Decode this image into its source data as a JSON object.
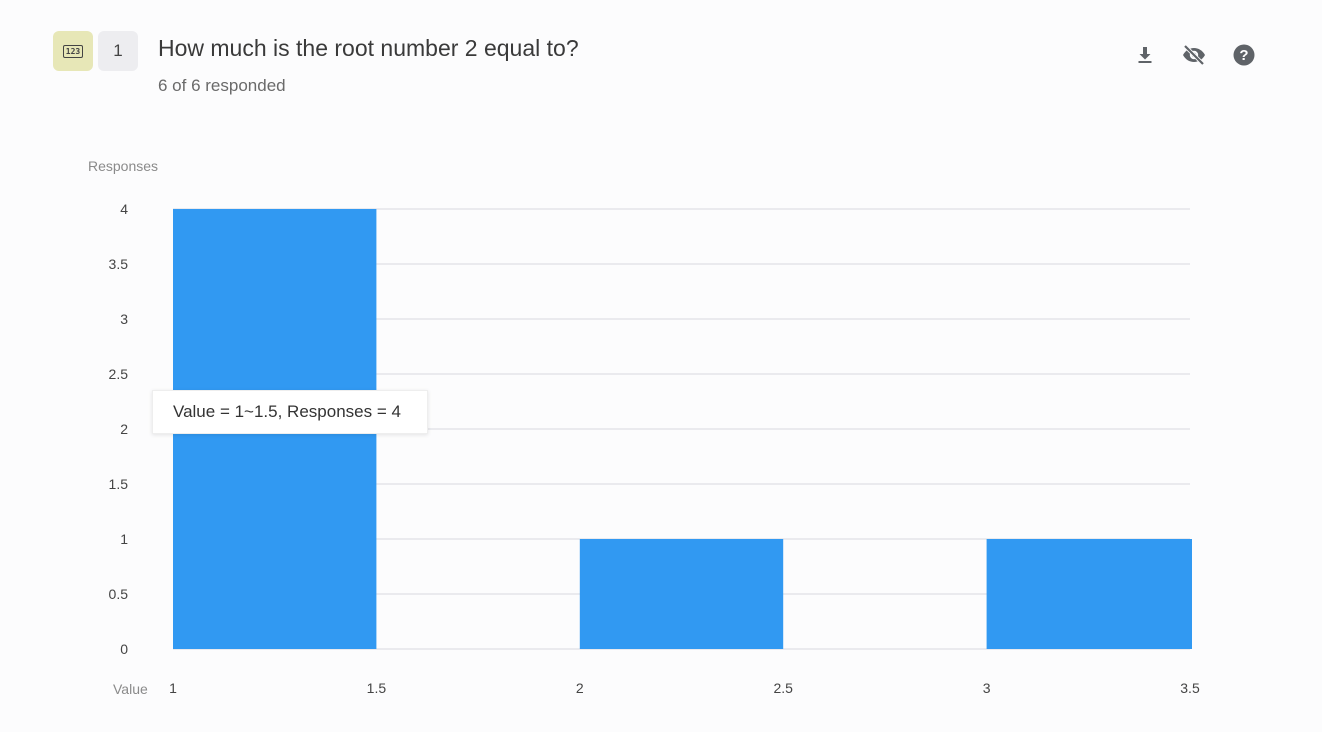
{
  "question": {
    "type_icon": "number-question-icon",
    "type_glyph": "123",
    "number": "1",
    "title": "How much is the root number 2 equal to?",
    "responded": "6 of 6 responded"
  },
  "toolbar": {
    "download_icon": "download-icon",
    "hide_icon": "eye-off-icon",
    "help_icon": "help-icon"
  },
  "tooltip": {
    "text": "Value = 1~1.5, Responses = 4"
  },
  "colors": {
    "bar": "#3199f2",
    "grid": "#e3e4ea",
    "axis_text": "#444444",
    "axis_title": "#8a8a8a"
  },
  "chart_data": {
    "type": "bar",
    "title": "",
    "xlabel": "Value",
    "ylabel": "Responses",
    "xlim": [
      1,
      3.5
    ],
    "ylim": [
      0,
      4
    ],
    "x_ticks": [
      "1",
      "1.5",
      "2",
      "2.5",
      "3",
      "3.5"
    ],
    "y_ticks": [
      "0",
      "0.5",
      "1",
      "1.5",
      "2",
      "2.5",
      "3",
      "3.5",
      "4"
    ],
    "bins": [
      {
        "from": 1,
        "to": 1.5,
        "value": 4
      },
      {
        "from": 2,
        "to": 2.5,
        "value": 1
      },
      {
        "from": 3,
        "to": 3.5,
        "value": 1
      }
    ],
    "grid": true
  }
}
